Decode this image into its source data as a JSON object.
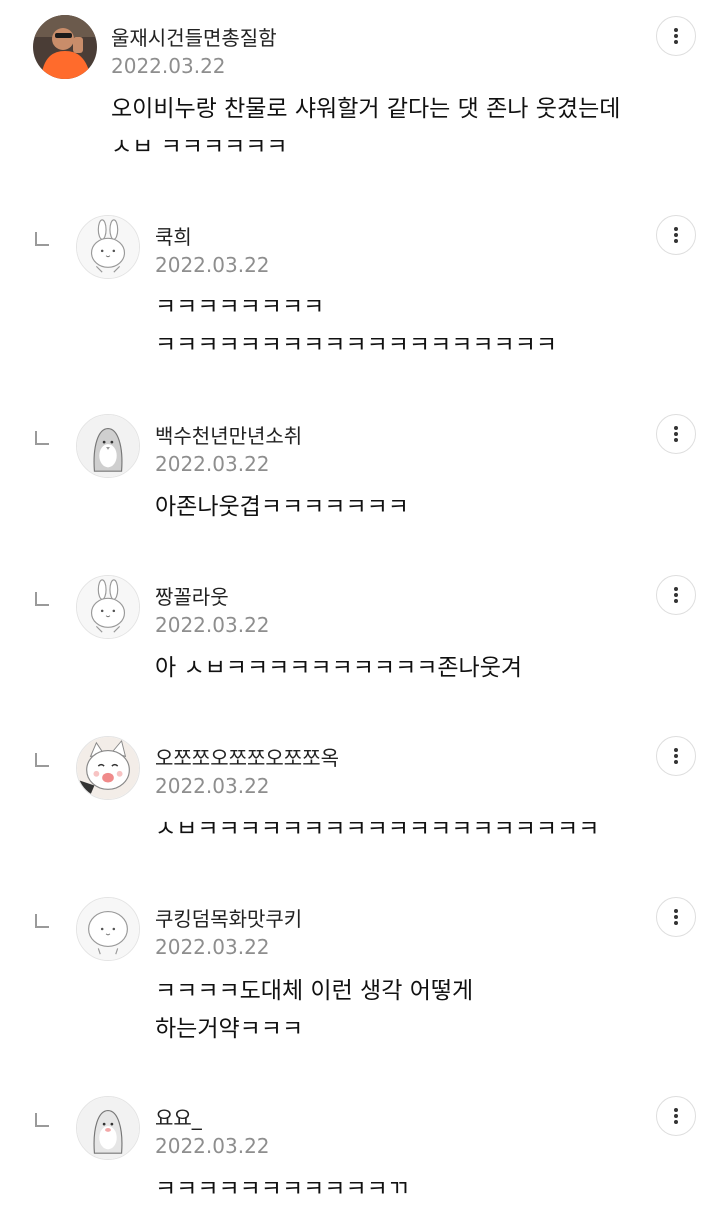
{
  "comments": [
    {
      "name": "울재시건들면총질함",
      "date": "2022.03.22",
      "lines": [
        "오이비누랑 찬물로 샤워할거 같다는 댓 존나 웃겼는데",
        "ㅅㅂ ㅋㅋㅋㅋㅋㅋ"
      ],
      "avatar": "photo-man-orange-shirt"
    },
    {
      "name": "쿡희",
      "date": "2022.03.22",
      "lines": [
        "ㅋㅋㅋㅋㅋㅋㅋㅋ",
        "ㅋㅋㅋㅋㅋㅋㅋㅋㅋㅋㅋㅋㅋㅋㅋㅋㅋㅋㅋ"
      ],
      "avatar": "default-rabbit-avatar"
    },
    {
      "name": "백수천년만년소취",
      "date": "2022.03.22",
      "lines": [
        "아존나웃겹ㅋㅋㅋㅋㅋㅋㅋ"
      ],
      "avatar": "default-penguin-avatar"
    },
    {
      "name": "짱꼴라웃",
      "date": "2022.03.22",
      "lines": [
        "아 ㅅㅂㅋㅋㅋㅋㅋㅋㅋㅋㅋㅋ존나웃겨"
      ],
      "avatar": "default-rabbit-avatar"
    },
    {
      "name": "오쪼쪼오쪼쪼오쪼쪼옥",
      "date": "2022.03.22",
      "lines": [
        "ㅅㅂㅋㅋㅋㅋㅋㅋㅋㅋㅋㅋㅋㅋㅋㅋㅋㅋㅋㅋㅋ"
      ],
      "avatar": "cartoon-cat-avatar"
    },
    {
      "name": "쿠킹덤목화맛쿠키",
      "date": "2022.03.22",
      "lines": [
        "ㅋㅋㅋㅋ도대체 이런 생각 어떻게",
        "하는거약ㅋㅋㅋ"
      ],
      "avatar": "default-blob-avatar"
    },
    {
      "name": "요요_",
      "date": "2022.03.22",
      "lines": [
        "ㅋㅋㅋㅋㅋㅋㅋㅋㅋㅋㅋㄲ"
      ],
      "avatar": "default-penguin-avatar"
    }
  ],
  "icons": {
    "more": "vertical-dots-icon",
    "reply": "reply-corner-icon"
  }
}
